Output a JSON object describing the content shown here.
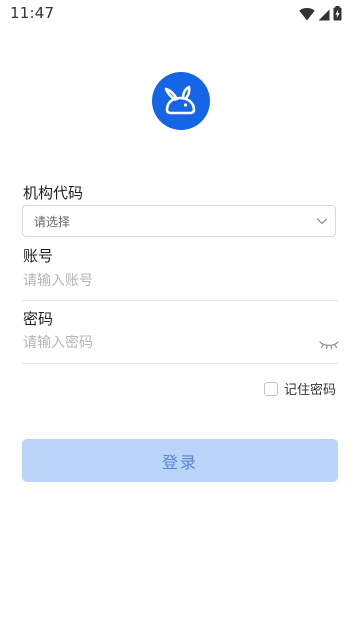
{
  "status_bar": {
    "time": "11:47",
    "icons": [
      "wifi-icon",
      "cellular-signal-icon",
      "battery-charging-icon"
    ]
  },
  "logo": {
    "icon": "rabbit-logo-icon",
    "background_color": "#1466e6"
  },
  "form": {
    "org_code": {
      "label": "机构代码",
      "selected": "请选择",
      "icon": "chevron-down-icon"
    },
    "account": {
      "label": "账号",
      "placeholder": "请输入账号",
      "value": ""
    },
    "password": {
      "label": "密码",
      "placeholder": "请输入密码",
      "value": "",
      "visibility_icon": "eye-closed-icon"
    },
    "remember": {
      "label": "记住密码",
      "checked": false
    },
    "submit": {
      "label": "登录",
      "enabled": false,
      "background_color": "#b9d4f8",
      "text_color": "#5787d9"
    }
  }
}
